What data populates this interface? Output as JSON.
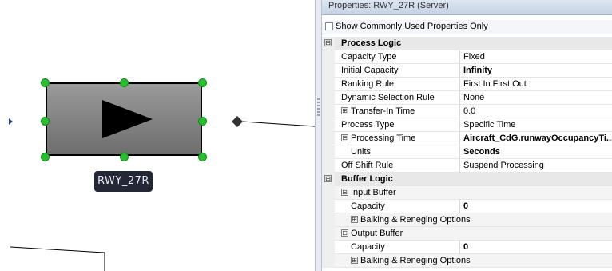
{
  "canvas": {
    "object_label": "RWY_27R",
    "accent_handle_color": "#22c22a"
  },
  "panel": {
    "title": "Properties: RWY_27R (Server)",
    "show_common_label": "Show Commonly Used Properties Only",
    "show_common_checked": false,
    "rows": [
      {
        "kind": "category",
        "label": "Process Logic",
        "expander": "⊟"
      },
      {
        "kind": "prop",
        "label": "Capacity Type",
        "value": "Fixed"
      },
      {
        "kind": "prop",
        "label": "Initial Capacity",
        "value": "Infinity",
        "bold": true
      },
      {
        "kind": "prop",
        "label": "Ranking Rule",
        "value": "First In First Out"
      },
      {
        "kind": "prop",
        "label": "Dynamic Selection Rule",
        "value": "None"
      },
      {
        "kind": "prop",
        "label": "Transfer-In Time",
        "value": "0.0",
        "expander": "⊞"
      },
      {
        "kind": "prop",
        "label": "Process Type",
        "value": "Specific Time"
      },
      {
        "kind": "prop",
        "label": "Processing Time",
        "value": "Aircraft_CdG.runwayOccupancyTi...",
        "bold": true,
        "expander": "⊟"
      },
      {
        "kind": "prop",
        "label": "Units",
        "value": "Seconds",
        "bold": true,
        "indent": 1
      },
      {
        "kind": "prop",
        "label": "Off Shift Rule",
        "value": "Suspend Processing"
      },
      {
        "kind": "category",
        "label": "Buffer Logic",
        "expander": "⊟"
      },
      {
        "kind": "sub",
        "label": "Input Buffer",
        "expander": "⊟"
      },
      {
        "kind": "prop",
        "label": "Capacity",
        "value": "0",
        "bold": true,
        "indent": 1
      },
      {
        "kind": "sub",
        "label": "Balking & Reneging Options",
        "expander": "⊞",
        "indent": 1
      },
      {
        "kind": "sub",
        "label": "Output Buffer",
        "expander": "⊟"
      },
      {
        "kind": "prop",
        "label": "Capacity",
        "value": "0",
        "bold": true,
        "indent": 1
      },
      {
        "kind": "sub",
        "label": "Balking & Reneging Options",
        "expander": "⊞",
        "indent": 1
      }
    ]
  }
}
